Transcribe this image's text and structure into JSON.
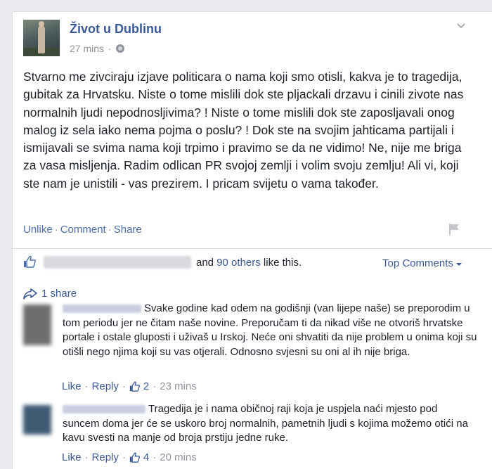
{
  "post": {
    "page_name": "Život u Dublinu",
    "time": "27 mins",
    "privacy_icon": "globe-icon",
    "text": "Stvarno me zivciraju izjave politicara o nama koji smo otisli, kakva je to tragedija, gubitak za Hrvatsku. Niste o tome mislili dok ste pljackali drzavu i cinili zivote nas normalnih ljudi nepodnosljivima? ! Niste o tome mislili dok ste zaposljavali onog malog iz sela iako nema pojma o poslu? ! Dok ste na svojim jahticama partijali i ismijavali se svima nama koji trpimo i pravimo se da ne vidimo! Ne, nije me briga za vasa misljenja. Radim odlican PR svojoj zemlji i volim svoju zemlju! Ali vi, koji ste nam je unistili - vas prezirem. I pricam svijetu o vama također.",
    "actions": {
      "unlike": "Unlike",
      "comment": "Comment",
      "share": "Share"
    }
  },
  "likes": {
    "and_text": "and",
    "others_link": "90 others",
    "suffix": "like this.",
    "top_comments": "Top Comments"
  },
  "shares": {
    "label": "1 share"
  },
  "comments": [
    {
      "text": "Svake godine kad odem na godišnji (van lijepe naše) se preporodim u tom periodu jer ne čitam naše novine. Preporučam ti da nikad više ne otvoriš hrvatske portale i ostale gluposti i uživaš u Irskoj. Neće oni shvatiti da nije problem u onima koji su otišli nego njima koji su vas otjerali. Odnosno svjesni su oni al ih nije briga.",
      "like": "Like",
      "reply": "Reply",
      "likes": "2",
      "time": "23 mins"
    },
    {
      "text": "Tragedija je i nama običnoj raji koja je uspjela naći mjesto pod suncem doma jer će se uskoro broj normalnih, pametnih ljudi s kojima možemo otići na kavu svesti na manje od broja prstiju jedne ruke.",
      "like": "Like",
      "reply": "Reply",
      "likes": "4",
      "time": "20 mins"
    }
  ],
  "colors": {
    "link": "#3b5998",
    "meta": "#90949c",
    "text": "#1d2129",
    "background": "#e9ebee"
  }
}
